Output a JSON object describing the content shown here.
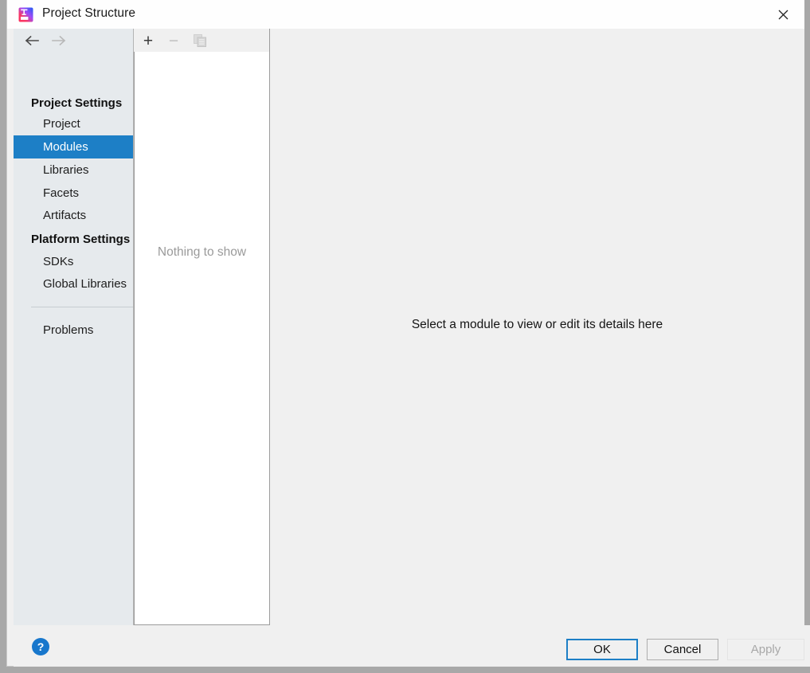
{
  "window": {
    "title": "Project Structure",
    "app_icon": "intellij-idea-logo",
    "close_label": "✕"
  },
  "navigation": {
    "back_icon": "arrow-left-icon",
    "forward_icon": "arrow-right-icon",
    "back_enabled": true,
    "forward_enabled": false
  },
  "sidebar": {
    "groups": [
      {
        "label": "Project Settings",
        "items": [
          {
            "label": "Project",
            "selected": false
          },
          {
            "label": "Modules",
            "selected": true
          },
          {
            "label": "Libraries",
            "selected": false
          },
          {
            "label": "Facets",
            "selected": false
          },
          {
            "label": "Artifacts",
            "selected": false
          }
        ]
      },
      {
        "label": "Platform Settings",
        "items": [
          {
            "label": "SDKs",
            "selected": false
          },
          {
            "label": "Global Libraries",
            "selected": false
          }
        ]
      }
    ],
    "extra_items": [
      {
        "label": "Problems",
        "selected": false
      }
    ]
  },
  "module_panel": {
    "toolbar": {
      "add": {
        "label": "+",
        "icon": "plus-icon",
        "enabled": true
      },
      "remove": {
        "label": "−",
        "icon": "minus-icon",
        "enabled": false
      },
      "copy": {
        "label": "",
        "icon": "copy-icon",
        "enabled": false
      }
    },
    "empty_text": "Nothing to show"
  },
  "detail_panel": {
    "message": "Select a module to view or edit its details here"
  },
  "footer": {
    "help_label": "?",
    "help_icon": "question-mark-icon",
    "buttons": [
      {
        "label": "OK",
        "state": "default-focused"
      },
      {
        "label": "Cancel",
        "state": "normal"
      },
      {
        "label": "Apply",
        "state": "disabled"
      }
    ]
  },
  "colors": {
    "accent": "#1d7fc6",
    "sidebar_bg": "#e6eaed",
    "panel_bg": "#f0f0f0",
    "list_bg": "#ffffff",
    "help_blue": "#1877cc"
  }
}
